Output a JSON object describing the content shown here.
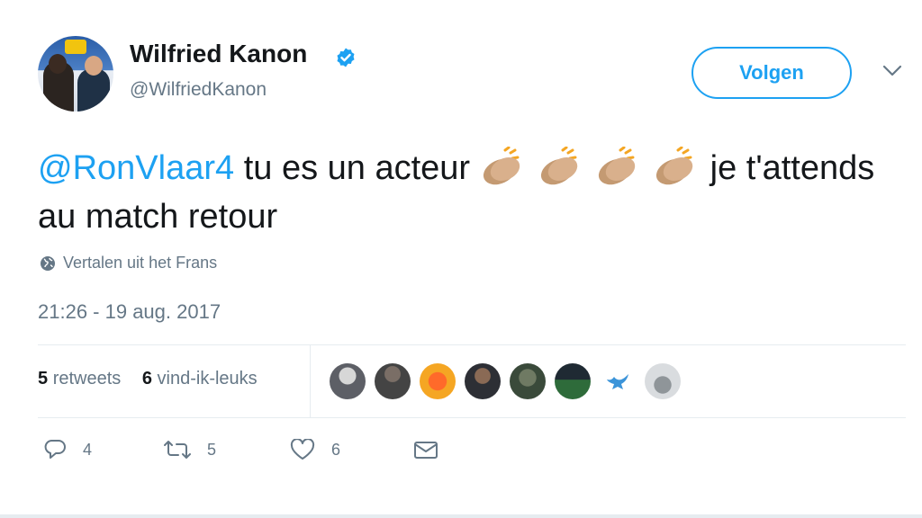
{
  "user": {
    "name": "Wilfried Kanon",
    "handle": "@WilfriedKanon",
    "verified_icon": "verified-badge-icon"
  },
  "follow_button": "Volgen",
  "tweet": {
    "mention": "@RonVlaar4",
    "text_a": " tu es un acteur ",
    "emoji": "clapping-hands-emoji",
    "emoji_count": 4,
    "text_b": "je t'attends au match retour"
  },
  "translate": "Vertalen uit het Frans",
  "timestamp": "21:26 - 19 aug. 2017",
  "stats": {
    "retweets_count": "5",
    "retweets_label": "retweets",
    "likes_count": "6",
    "likes_label": "vind-ik-leuks"
  },
  "actions": {
    "reply_count": "4",
    "retweet_count": "5",
    "like_count": "6"
  },
  "colors": {
    "accent": "#1da1f2",
    "muted": "#657786",
    "text": "#14171a"
  }
}
